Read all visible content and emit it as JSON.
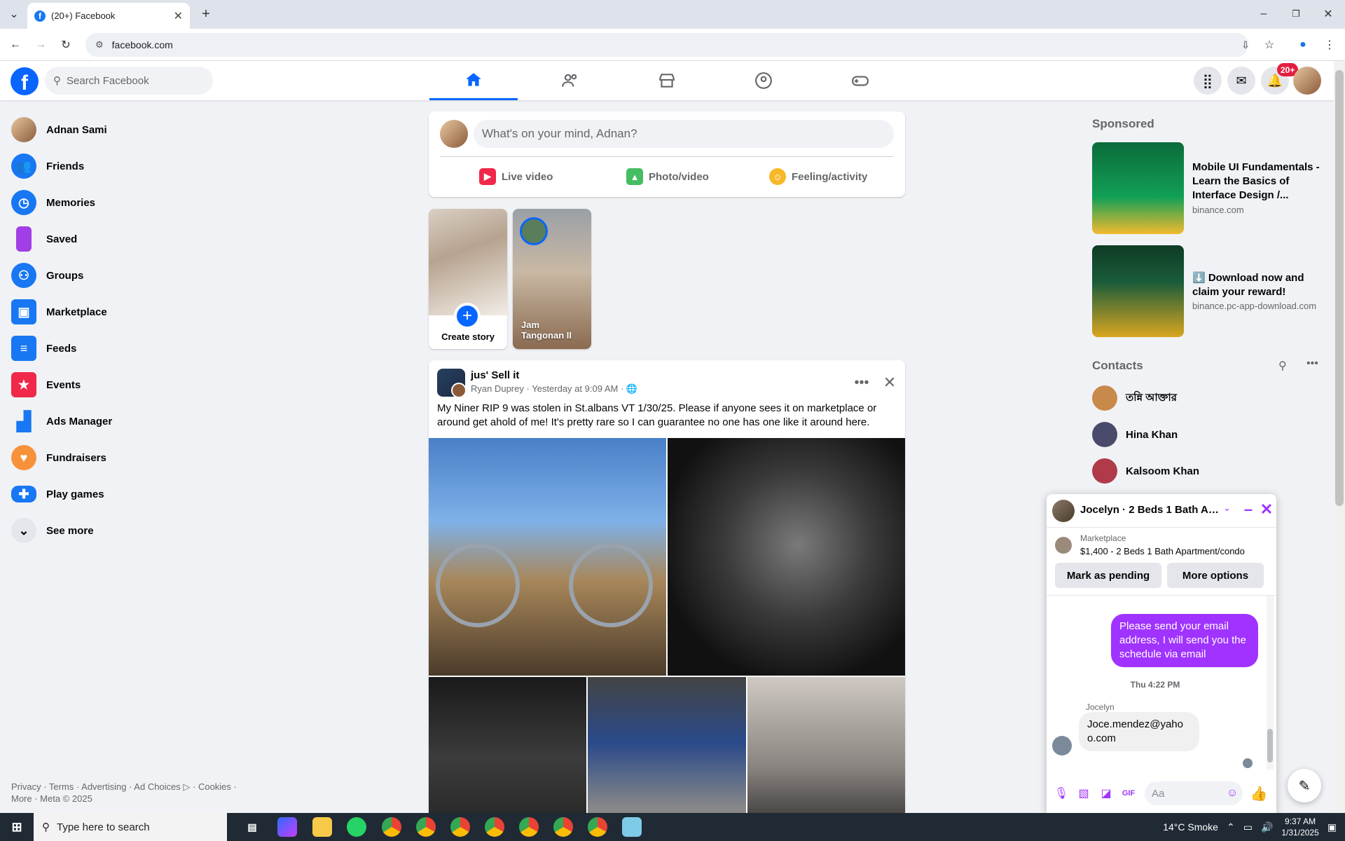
{
  "browser": {
    "tab_title": "(20+) Facebook",
    "url": "facebook.com"
  },
  "header": {
    "search_placeholder": "Search Facebook",
    "notification_badge": "20+"
  },
  "sidebar": {
    "items": [
      {
        "label": "Adnan Sami",
        "icon": "profile-avatar",
        "color": "#c89a6a"
      },
      {
        "label": "Friends",
        "icon": "friends-icon",
        "color": "#1877f2"
      },
      {
        "label": "Memories",
        "icon": "clock-icon",
        "color": "#1877f2"
      },
      {
        "label": "Saved",
        "icon": "bookmark-icon",
        "color": "#a23ee5"
      },
      {
        "label": "Groups",
        "icon": "groups-icon",
        "color": "#1877f2"
      },
      {
        "label": "Marketplace",
        "icon": "shop-icon",
        "color": "#1877f2"
      },
      {
        "label": "Feeds",
        "icon": "feeds-icon",
        "color": "#1877f2"
      },
      {
        "label": "Events",
        "icon": "calendar-icon",
        "color": "#f02849"
      },
      {
        "label": "Ads Manager",
        "icon": "bar-chart-icon",
        "color": "#1877f2"
      },
      {
        "label": "Fundraisers",
        "icon": "heart-icon",
        "color": "#f7923a"
      },
      {
        "label": "Play games",
        "icon": "gamepad-icon",
        "color": "#1877f2"
      },
      {
        "label": "See more",
        "icon": "chevron-down-icon",
        "color": "#e4e6eb"
      }
    ],
    "footer_line1": "Privacy · Terms · Advertising · Ad Choices ▷ · Cookies ·",
    "footer_line2": "More · Meta © 2025"
  },
  "composer": {
    "placeholder": "What's on your mind, Adnan?",
    "live_video": "Live video",
    "photo_video": "Photo/video",
    "feeling": "Feeling/activity"
  },
  "stories": {
    "create_label": "Create story",
    "story2_name": "Jam Tangonan II"
  },
  "post": {
    "group_name": "jus' Sell it",
    "author": "Ryan Duprey",
    "time": "Yesterday at 9:09 AM",
    "text": "My Niner RIP 9 was stolen in St.albans VT 1/30/25. Please if anyone sees it on marketplace or around get ahold of me! It's pretty rare so I can guarantee no one has one like it around here."
  },
  "right": {
    "sponsored_heading": "Sponsored",
    "ads": [
      {
        "title": "Mobile UI Fundamentals - Learn the Basics of Interface Design /...",
        "url": "binance.com"
      },
      {
        "title": "⬇️ Download now and claim your reward!",
        "url": "binance.pc-app-download.com"
      }
    ],
    "contacts_heading": "Contacts",
    "contacts": [
      {
        "name": "তন্নি আক্তার",
        "color": "#c88a4a"
      },
      {
        "name": "Hina Khan",
        "color": "#4a4a6a"
      },
      {
        "name": "Kalsoom Khan",
        "color": "#b03a4a"
      }
    ]
  },
  "chat": {
    "title": "Jocelyn · 2 Beds 1 Bath Ap...",
    "marketplace_label": "Marketplace",
    "listing": "$1,400 - 2 Beds 1 Bath Apartment/condo",
    "mark_pending": "Mark as pending",
    "more_options": "More options",
    "outgoing_msg": "Please send your email address, I will send you the schedule via email",
    "timestamp": "Thu 4:22 PM",
    "sender": "Jocelyn",
    "incoming_msg": "Joce.mendez@yahoo.com",
    "input_placeholder": "Aa",
    "accent": "#a033ff"
  },
  "taskbar": {
    "search_placeholder": "Type here to search",
    "weather": "14°C  Smoke",
    "time": "9:37 AM",
    "date": "1/31/2025"
  }
}
